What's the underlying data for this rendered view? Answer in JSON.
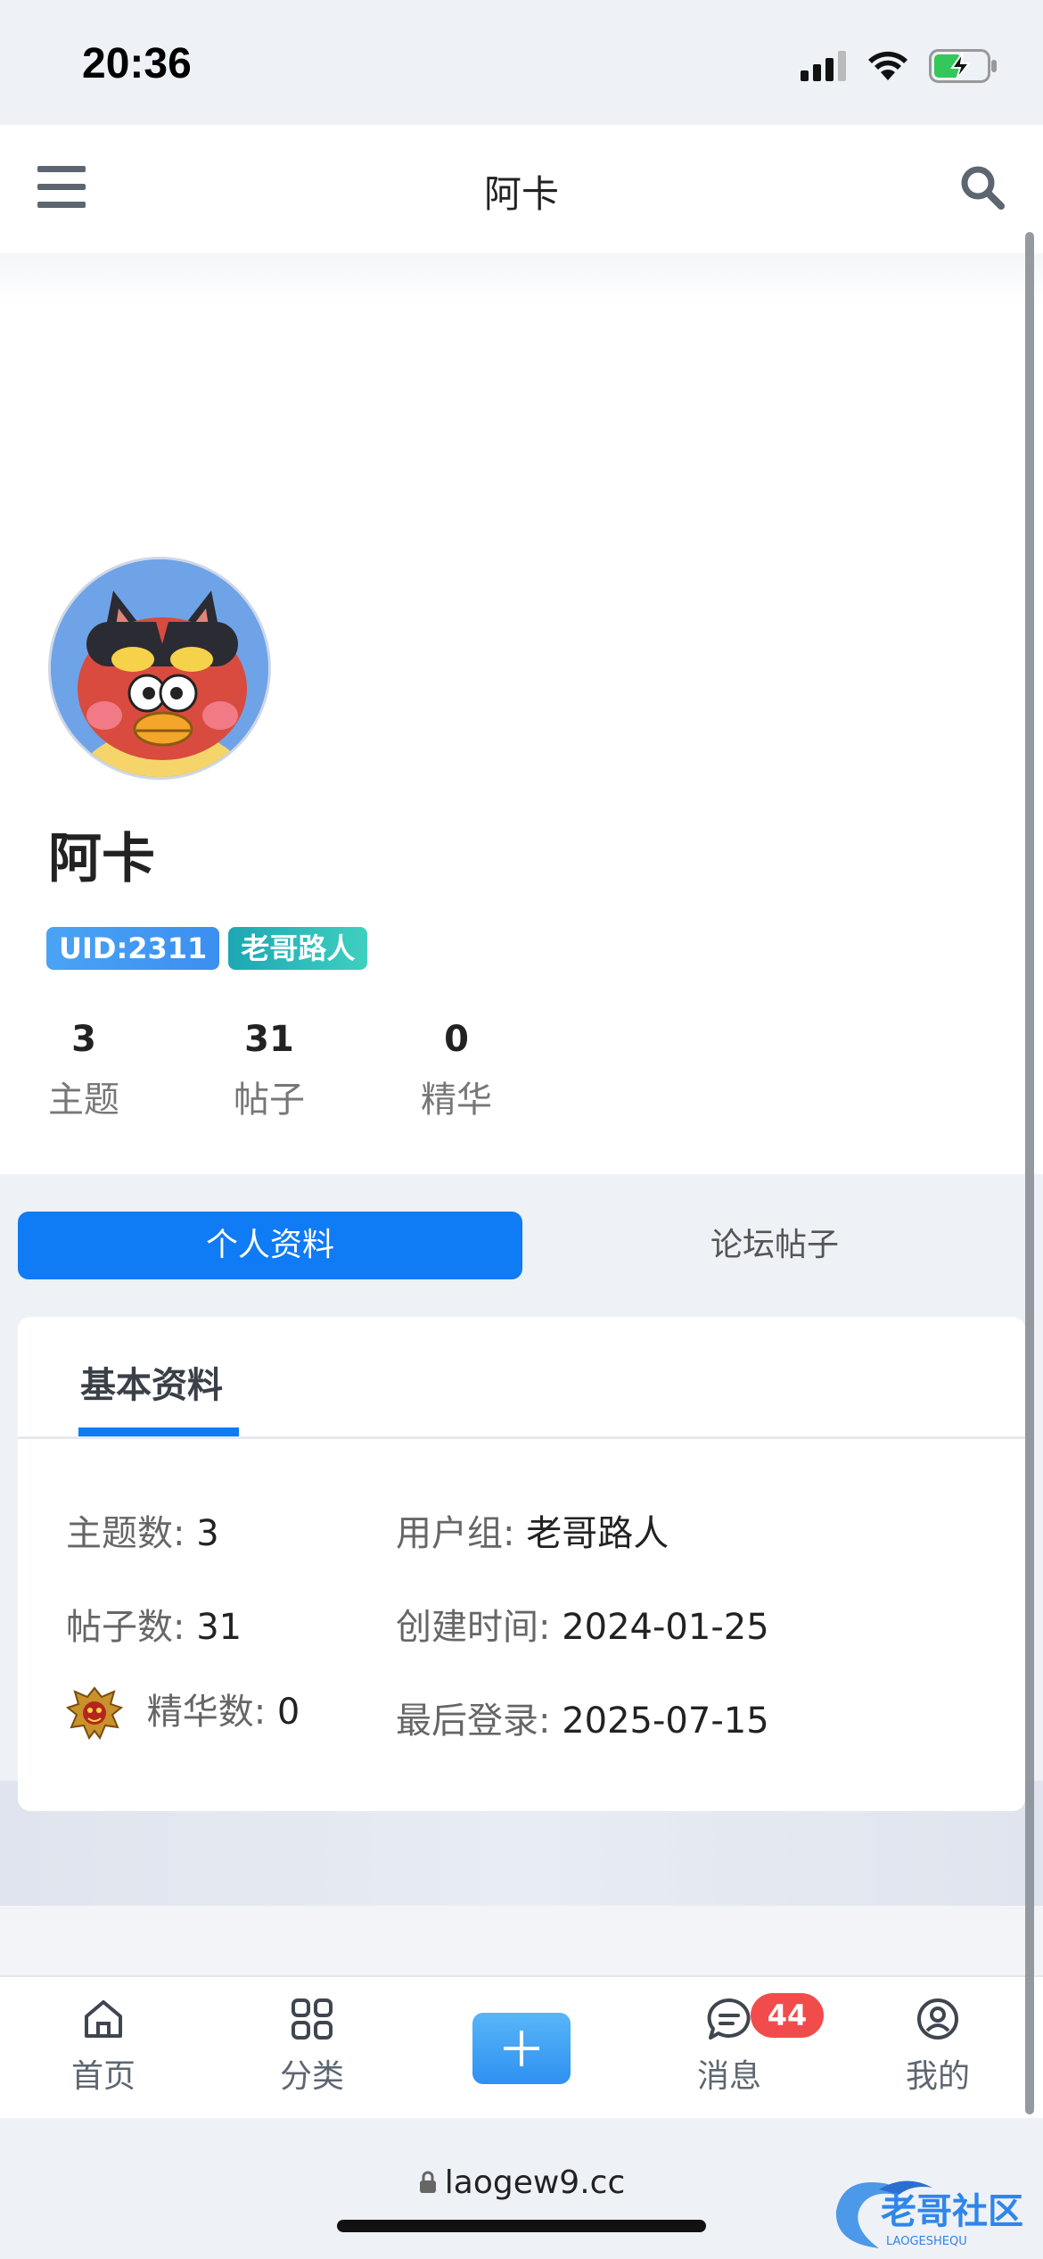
{
  "status_bar": {
    "time": "20:36",
    "icons": [
      "cellular-icon",
      "wifi-icon",
      "battery-charging-icon"
    ]
  },
  "header": {
    "title": "阿卡",
    "icons": [
      "menu-icon",
      "search-icon"
    ]
  },
  "profile": {
    "name": "阿卡",
    "uid_badge": "UID:2311",
    "group_badge": "老哥路人",
    "stats": [
      {
        "value": "3",
        "label": "主题"
      },
      {
        "value": "31",
        "label": "帖子"
      },
      {
        "value": "0",
        "label": "精华"
      }
    ]
  },
  "tabs": {
    "active": "个人资料",
    "inactive": "论坛帖子"
  },
  "info_card": {
    "tab": "基本资料",
    "rows": [
      {
        "k": "主题数:",
        "v": "3"
      },
      {
        "k": "用户组:",
        "v": "老哥路人"
      },
      {
        "k": "帖子数:",
        "v": "31"
      },
      {
        "k": "创建时间:",
        "v": "2024-01-25"
      },
      {
        "k": "精华数:",
        "v": "0"
      },
      {
        "k": "最后登录:",
        "v": "2025-07-15"
      }
    ]
  },
  "bottom_nav": {
    "items": [
      {
        "label": "首页",
        "icon": "home-icon"
      },
      {
        "label": "分类",
        "icon": "grid-icon"
      },
      {
        "label": "",
        "icon": "plus-icon"
      },
      {
        "label": "消息",
        "icon": "message-icon"
      },
      {
        "label": "我的",
        "icon": "user-icon"
      }
    ],
    "message_badge": "44"
  },
  "browser": {
    "url": "laogew9.cc"
  },
  "watermark": {
    "text": "老哥社区",
    "subtext": "LAOGESHEQU"
  },
  "colors": {
    "accent": "#0f7bf5",
    "badge_red": "#f24b4b",
    "uid_badge": "#3b8ff0",
    "group_badge": "#1da7b3"
  }
}
